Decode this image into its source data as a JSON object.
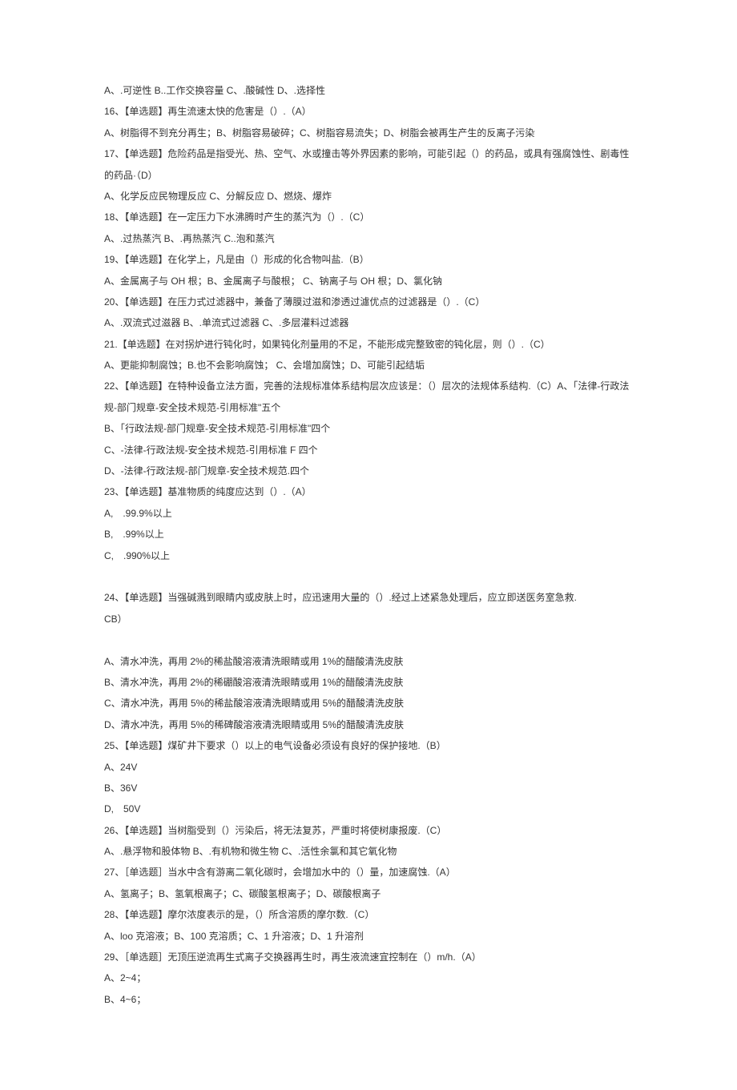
{
  "lines": [
    "A、.可逆性 B..工作交换容量 C、.酸碱性 D、.选择性",
    "16、【单选题】再生流速太快的危害是（）.（A）",
    "A、树脂得不到充分再生；B、树脂容易破碎；C、树脂容易流失；D、树脂会被再生产生的反离子污染",
    "17、【单选题】危险药品是指受光、热、空气、水或撞击等外界因素的影响，可能引起（）的药品，或具有强腐蚀性、剧毒性的药品·（D）",
    "A、化学反应民物理反应 C、分解反应 D、燃烧、爆炸",
    "18、【单选题】在一定压力下水沸腾时产生的蒸汽为（）.（C）",
    "A、.过热蒸汽 B、.再热蒸汽 C..泡和蒸汽",
    "19、【单选题】在化学上，凡是由（）形成的化合物叫盐.（B）",
    "A、金属离子与 OH 根；B、金属离子与酸根； C、钠离子与 OH 根；D、氯化钠",
    "20、【单选题】在压力式过滤器中，兼备了薄膜过滋和渗透过濾优点的过滤器是（）.（C）",
    "A、.双流式过滋器 B、.单流式过滤器 C、.多层灌料过滤器",
    "21.【单选题】在对拐炉进行钝化时，如果钝化剂量用的不足，不能形成完整致密的钝化层，则（）.（C）",
    "A、更能抑制腐蚀；B.也不会影响腐蚀； C、会增加腐蚀；D、可能引起结垢",
    "22、【单选题】在特种设备立法方面，完善的法规标准体系结构层次应该是：（）层次的法规体系结构.（C）A、「法律-行政法规-部门规章-安全技术规范-引用标准\"五个",
    "B、「行政法规-部门规章-安全技术规范-引用标准\"四个",
    "C、-法律-行政法规-安全技术规范-引用标准 F 四个",
    "D、-法律-行政法规-部门规章-安全技术规范.四个",
    "23、【单选题】基准物质的纯度应达到（）.（A）",
    "A,　.99.9%以上",
    "B,　.99%以上",
    "C,　.990%以上",
    "",
    "24、【单选题】当强碱溅到眼睛内或皮肤上时，应迅速用大量的（）.经过上述紧急处理后，应立即送医务室急救.",
    "CB）",
    "",
    "A、清水冲洗，再用 2%的稀盐酸溶液清洗眼睛或用 1%的醋酸清洗皮肤",
    "B、清水冲洗，再用 2%的稀硼酸溶液清洗眼睛或用 1%的醋酸清洗皮肤",
    "C、清水冲洗，再用 5%的稀盐酸溶液清洗眼睛或用 5%的醋酸清洗皮肤",
    "D、清水冲洗，再用 5%的稀碑酸溶液清洗眼睛或用 5%的醋酸清洗皮肤",
    "25、【单选题】煤矿井下要求（）以上的电气设备必须设有良好的保护接地.（B）",
    "A、24V",
    "B、36V",
    "D,　50V",
    "26、【单选题】当树脂受到（）污染后，将无法复苏，严重时将使树康报废.（C）",
    "A、.悬浮物和股体物 B、.有机物和微生物 C、.活性余氯和其它氧化物",
    "27、［单选题］当水中含有游离二氧化碳时，会增加水中的（）量，加速腐蚀.（A）",
    "A、氢离子；B、氢氧根离子；C、碳酸氢根离子；D、碳酸根离子",
    "28、【单选题】摩尔浓度表示的是，（）所含溶质的摩尔数.（C）",
    "A、loo 克溶液；B、100 克溶质；C、1 升溶液；D、1 升溶剂",
    "29、［单选题］无顶压逆流再生式离子交换器再生时，再生液流速宜控制在（）m/h.（A）",
    "A、2~4；",
    "B、4~6；"
  ]
}
